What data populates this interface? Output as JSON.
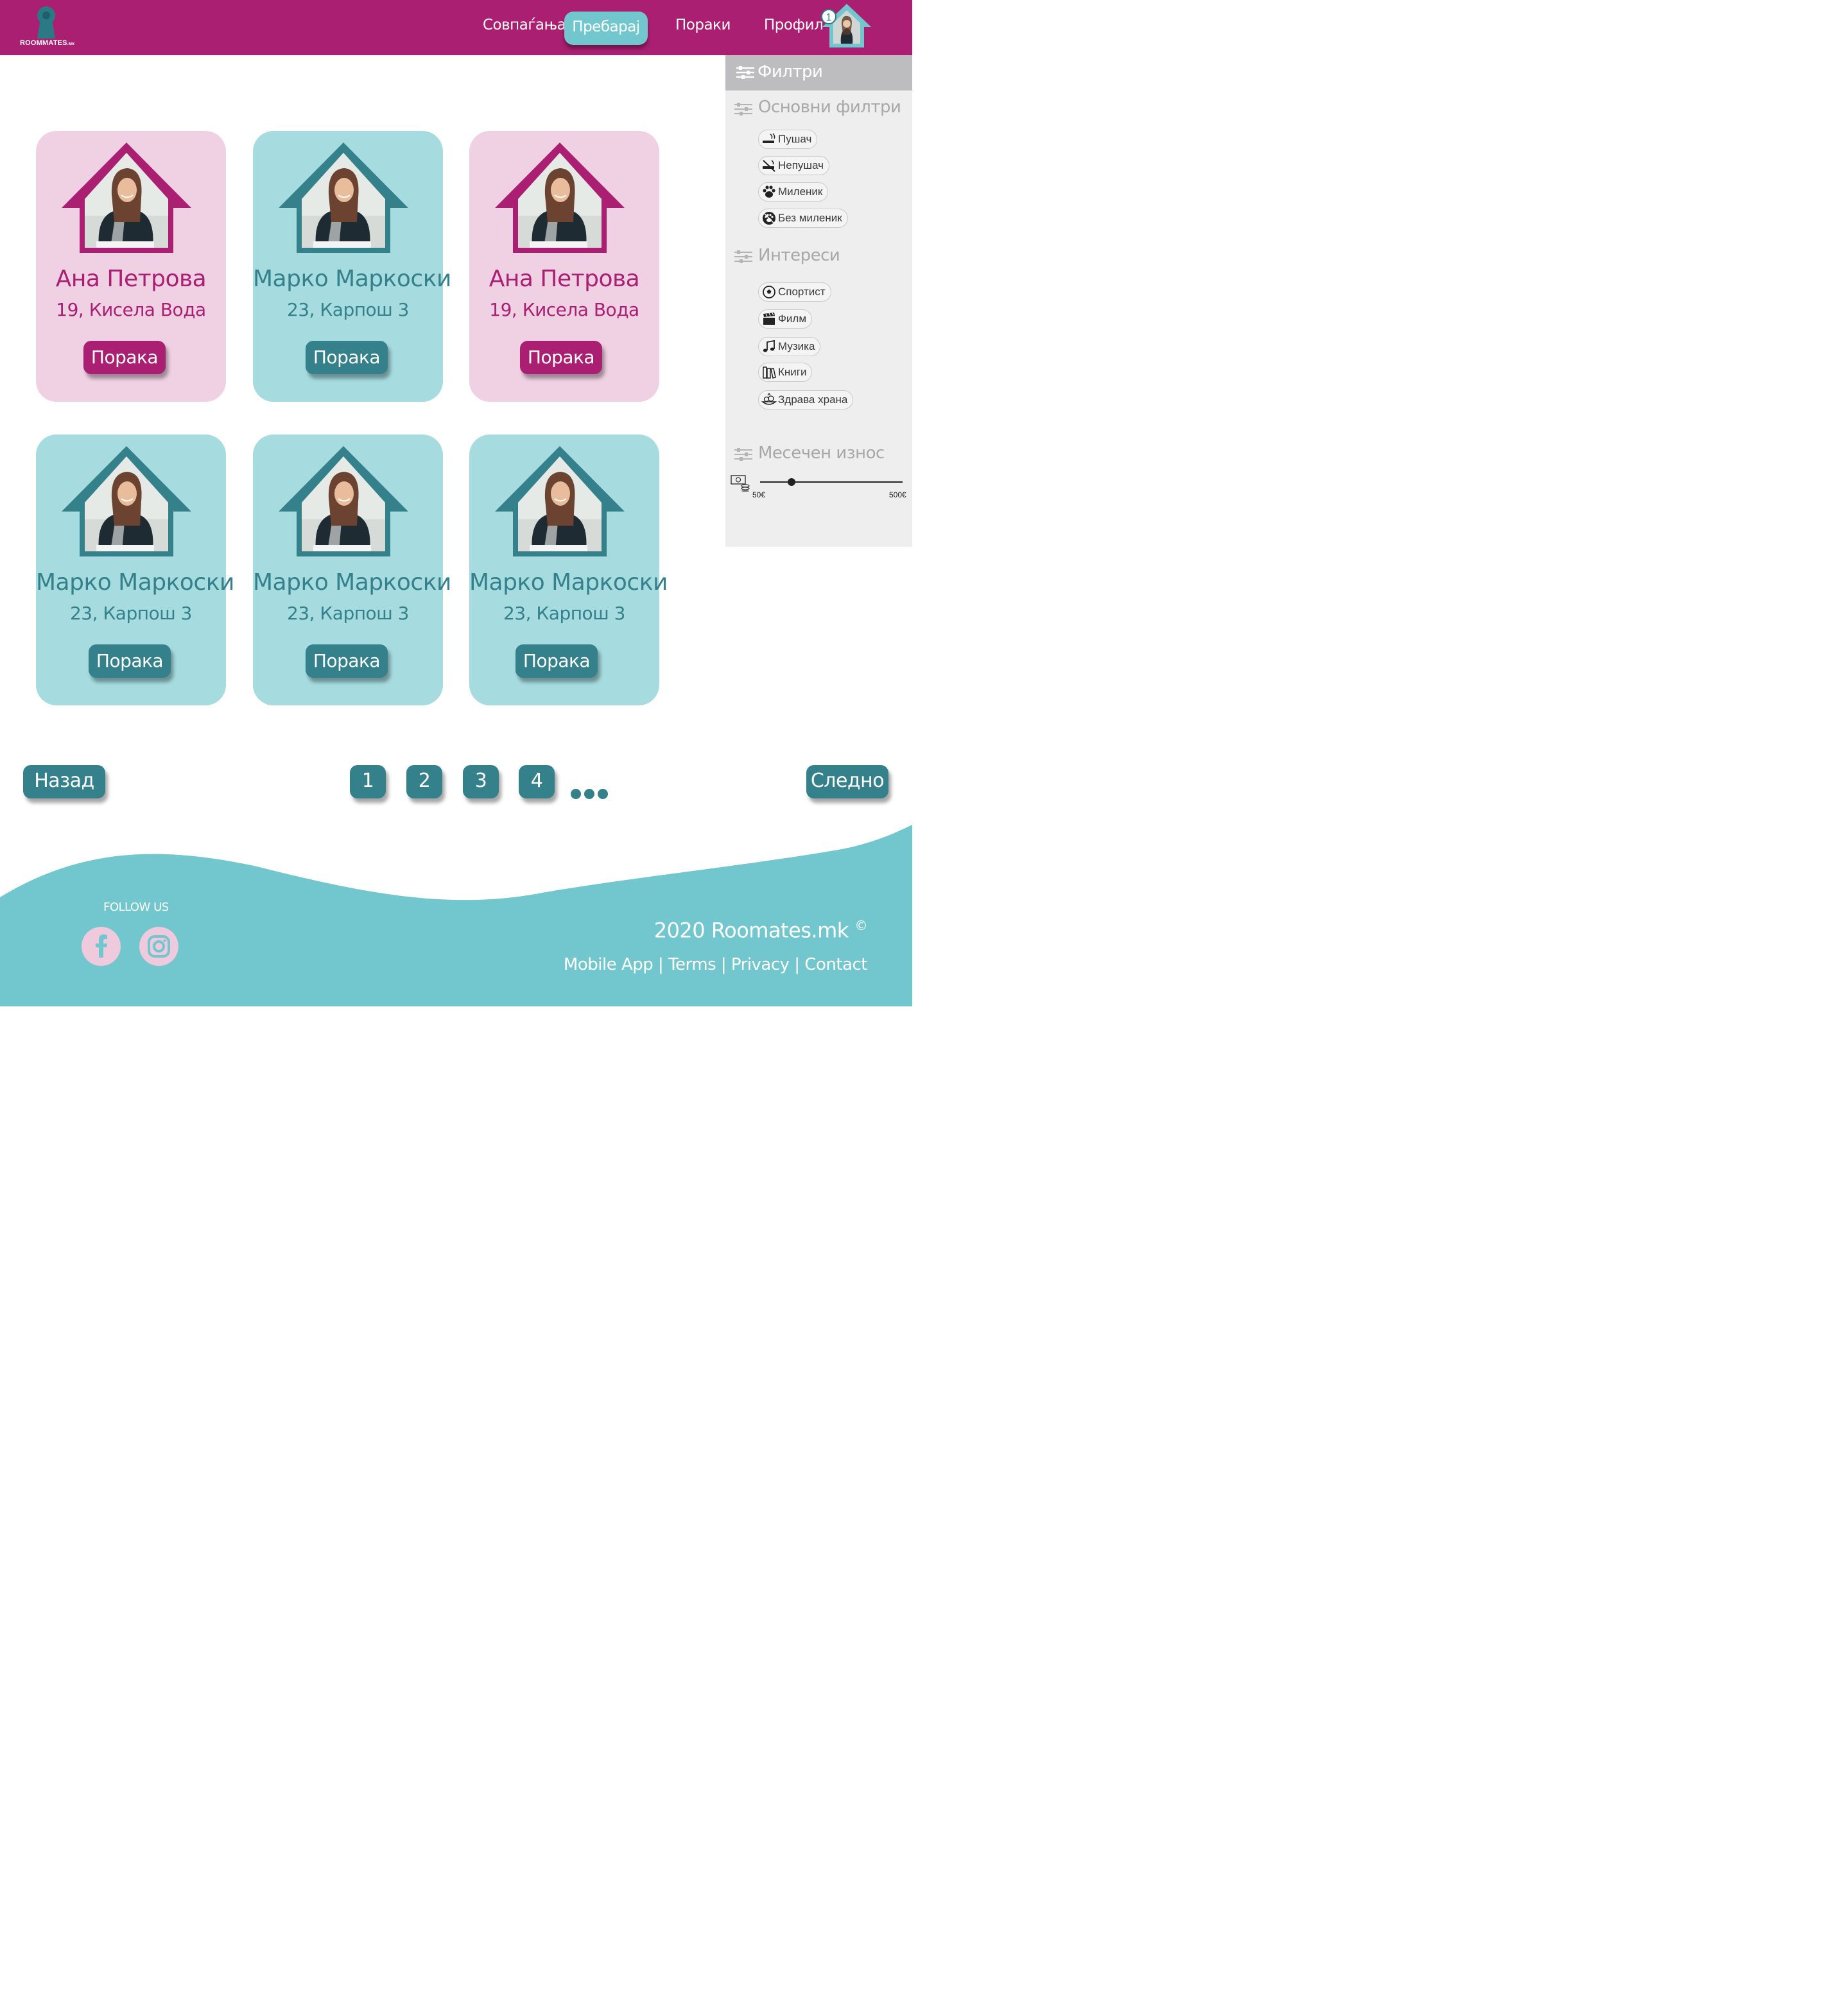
{
  "brand": {
    "logo_text": "ROOMMATES",
    "logo_suffix": ".мк"
  },
  "nav": {
    "items": [
      "Совпаѓања",
      "Пребарај",
      "Пораки",
      "Профил"
    ],
    "active": "Пребарај",
    "notification_count": "1"
  },
  "filters": {
    "title": "Филтри",
    "basic": {
      "title": "Основни филтри",
      "options": [
        "Пушач",
        "Непушач",
        "Миленик",
        "Без миленик"
      ]
    },
    "interests": {
      "title": "Интереси",
      "options": [
        "Спортист",
        "Филм",
        "Музика",
        "Книги",
        "Здрава храна"
      ]
    },
    "monthly": {
      "title": "Месечен износ",
      "min_label": "50€",
      "max_label": "500€",
      "value_fraction": 0.22
    }
  },
  "cards": [
    {
      "name": "Ана Петрова",
      "info": "19, Кисела Вода",
      "button": "Порака",
      "theme": "pink"
    },
    {
      "name": "Марко Маркоски",
      "info": "23, Карпош 3",
      "button": "Порака",
      "theme": "teal"
    },
    {
      "name": "Ана Петрова",
      "info": "19, Кисела Вода",
      "button": "Порака",
      "theme": "pink"
    },
    {
      "name": "Марко Маркоски",
      "info": "23, Карпош 3",
      "button": "Порака",
      "theme": "teal"
    },
    {
      "name": "Марко Маркоски",
      "info": "23, Карпош 3",
      "button": "Порака",
      "theme": "teal"
    },
    {
      "name": "Марко Маркоски",
      "info": "23, Карпош 3",
      "button": "Порака",
      "theme": "teal"
    }
  ],
  "pagination": {
    "back": "Назад",
    "next": "Следно",
    "pages": [
      "1",
      "2",
      "3",
      "4"
    ]
  },
  "footer": {
    "follow": "FOLLOW US",
    "social": [
      "facebook-icon",
      "instagram-icon"
    ],
    "copyright": "2020 Roomates.mk",
    "links_text": "Mobile App | Terms | Privacy | Contact"
  },
  "colors": {
    "brand": "#ab1f73",
    "teal": "#34808b",
    "teal_light": "#a6dce0",
    "pink_light": "#efd1e3",
    "footer": "#72c7cf"
  }
}
